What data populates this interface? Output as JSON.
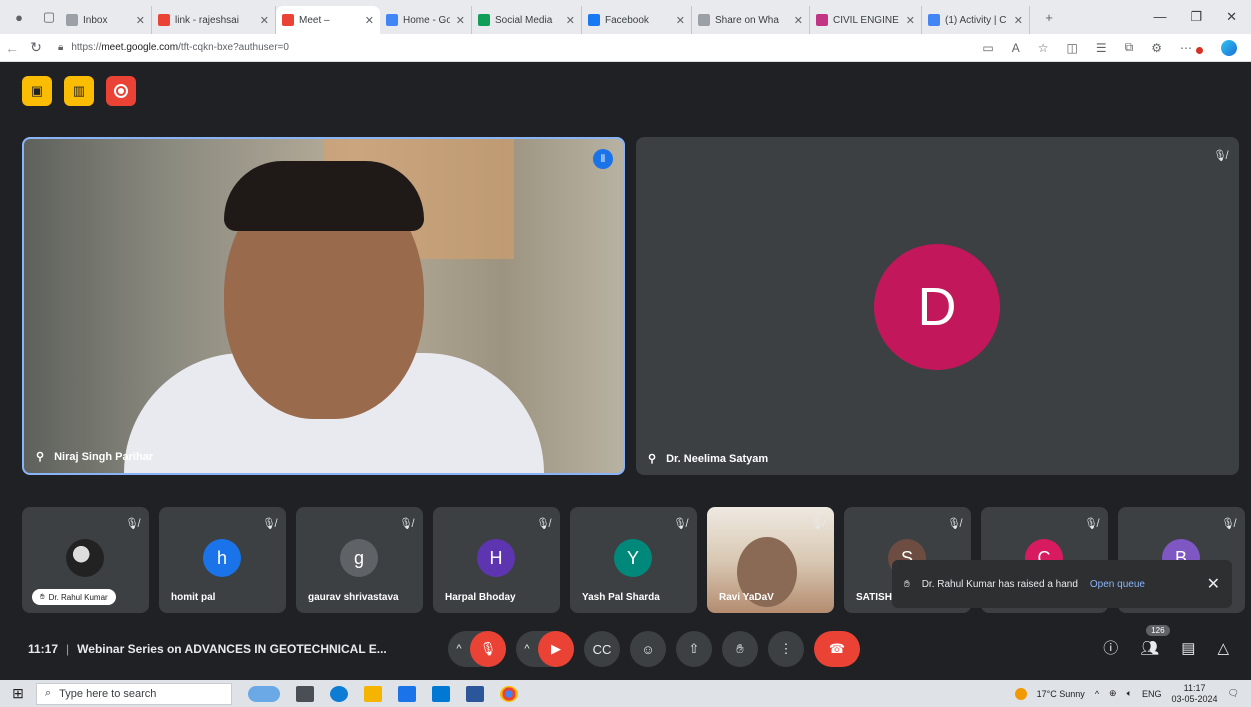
{
  "browser": {
    "tabs": [
      {
        "label": "Inbox",
        "color": "#9aa0a6",
        "active": false
      },
      {
        "label": "link - rajeshsai",
        "color": "#ea4335",
        "active": false
      },
      {
        "label": "Meet – ",
        "color": "#ea4335",
        "active": true
      },
      {
        "label": "Home - Googl",
        "color": "#4285f4",
        "active": false
      },
      {
        "label": "Social Media",
        "color": "#0f9d58",
        "active": false
      },
      {
        "label": "Facebook",
        "color": "#1877f2",
        "active": false
      },
      {
        "label": "Share on Wha",
        "color": "#9aa0a6",
        "active": false
      },
      {
        "label": "CIVIL ENGINE",
        "color": "#c13584",
        "active": false
      },
      {
        "label": "(1) Activity | C",
        "color": "#4285f4",
        "active": false
      }
    ],
    "url_prefix": "https://",
    "url_host": "meet.google.com",
    "url_path": "/tft-cqkn-bxe?authuser=0"
  },
  "speaker": {
    "name": "Niraj Singh Parihar"
  },
  "pinned2": {
    "name": "Dr. Neelima Satyam",
    "initial": "D",
    "color": "#c2185b"
  },
  "participants": [
    {
      "name": "Dr. Rahul Kumar",
      "type": "pill"
    },
    {
      "name": "homit pal",
      "initial": "h",
      "color": "#1a73e8"
    },
    {
      "name": "gaurav shrivastava",
      "initial": "g",
      "color": "#5f6368"
    },
    {
      "name": "Harpal Bhoday",
      "initial": "H",
      "color": "#5e35b1"
    },
    {
      "name": "Yash Pal Sharda",
      "initial": "Y",
      "color": "#00897b"
    },
    {
      "name": "Ravi YaDaV",
      "type": "photo"
    },
    {
      "name": "SATISH",
      "initial": "S",
      "color": "#6d4c41"
    },
    {
      "name": "",
      "initial": "C",
      "color": "#d81b60"
    },
    {
      "name": "",
      "initial": "B",
      "color": "#7e57c2"
    }
  ],
  "toast": {
    "message": "Dr. Rahul Kumar has raised a hand",
    "action": "Open queue"
  },
  "meeting": {
    "time": "11:17",
    "title": "Webinar Series on ADVANCES IN GEOTECHNICAL E...",
    "participant_count": "126"
  },
  "taskbar": {
    "search_placeholder": "Type here to search",
    "weather": "17°C  Sunny",
    "lang": "ENG",
    "clock_time": "11:17",
    "clock_date": "03-05-2024"
  }
}
